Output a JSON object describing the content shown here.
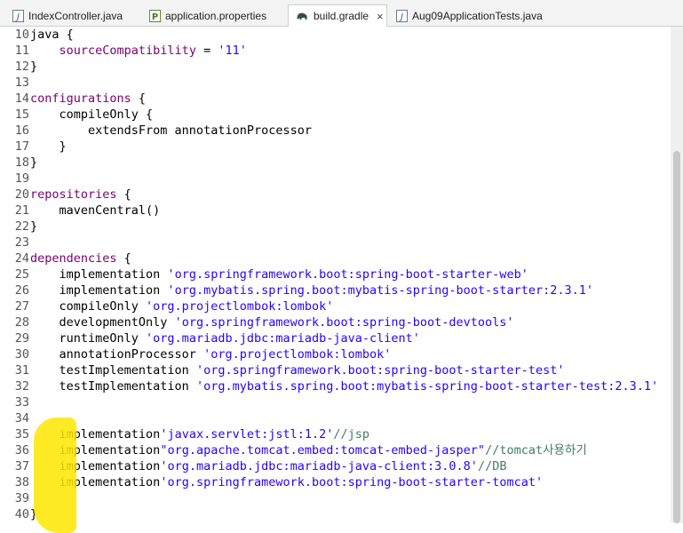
{
  "tabs": [
    {
      "label": "IndexController.java",
      "icon": "java-file-icon",
      "active": false
    },
    {
      "label": "application.properties",
      "icon": "properties-file-icon",
      "active": false
    },
    {
      "label": "build.gradle",
      "icon": "gradle-elephant-icon",
      "active": true,
      "close": "×"
    },
    {
      "label": "Aug09ApplicationTests.java",
      "icon": "java-file-icon",
      "active": false
    }
  ],
  "colors": {
    "string": "#2a00ff",
    "property": "#7a0070",
    "comment": "#3f7f5f",
    "highlight": "#ffe600"
  },
  "lines": [
    {
      "n": "10",
      "segs": [
        [
          "java {",
          ""
        ]
      ]
    },
    {
      "n": "11",
      "segs": [
        [
          "    ",
          ""
        ],
        [
          "sourceCompatibility",
          "prop"
        ],
        [
          " = ",
          ""
        ],
        [
          "'11'",
          "str"
        ]
      ]
    },
    {
      "n": "12",
      "segs": [
        [
          "}",
          ""
        ]
      ]
    },
    {
      "n": "13",
      "segs": []
    },
    {
      "n": "14",
      "segs": [
        [
          "configurations",
          "prop"
        ],
        [
          " {",
          ""
        ]
      ]
    },
    {
      "n": "15",
      "segs": [
        [
          "    compileOnly {",
          ""
        ]
      ]
    },
    {
      "n": "16",
      "segs": [
        [
          "        extendsFrom annotationProcessor",
          ""
        ]
      ]
    },
    {
      "n": "17",
      "segs": [
        [
          "    }",
          ""
        ]
      ]
    },
    {
      "n": "18",
      "segs": [
        [
          "}",
          ""
        ]
      ]
    },
    {
      "n": "19",
      "segs": []
    },
    {
      "n": "20",
      "segs": [
        [
          "repositories",
          "prop"
        ],
        [
          " {",
          ""
        ]
      ]
    },
    {
      "n": "21",
      "segs": [
        [
          "    mavenCentral()",
          ""
        ]
      ]
    },
    {
      "n": "22",
      "segs": [
        [
          "}",
          ""
        ]
      ]
    },
    {
      "n": "23",
      "segs": []
    },
    {
      "n": "24",
      "segs": [
        [
          "dependencies",
          "prop"
        ],
        [
          " {",
          ""
        ]
      ]
    },
    {
      "n": "25",
      "segs": [
        [
          "    implementation ",
          ""
        ],
        [
          "'org.springframework.boot:spring-boot-starter-web'",
          "str"
        ]
      ]
    },
    {
      "n": "26",
      "segs": [
        [
          "    implementation ",
          ""
        ],
        [
          "'org.mybatis.spring.boot:mybatis-spring-boot-starter:2.3.1'",
          "str"
        ]
      ]
    },
    {
      "n": "27",
      "segs": [
        [
          "    compileOnly ",
          ""
        ],
        [
          "'org.projectlombok:lombok'",
          "str"
        ]
      ]
    },
    {
      "n": "28",
      "segs": [
        [
          "    developmentOnly ",
          ""
        ],
        [
          "'org.springframework.boot:spring-boot-devtools'",
          "str"
        ]
      ]
    },
    {
      "n": "29",
      "segs": [
        [
          "    runtimeOnly ",
          ""
        ],
        [
          "'org.mariadb.jdbc:mariadb-java-client'",
          "str"
        ]
      ]
    },
    {
      "n": "30",
      "segs": [
        [
          "    annotationProcessor ",
          ""
        ],
        [
          "'org.projectlombok:lombok'",
          "str"
        ]
      ]
    },
    {
      "n": "31",
      "segs": [
        [
          "    testImplementation ",
          ""
        ],
        [
          "'org.springframework.boot:spring-boot-starter-test'",
          "str"
        ]
      ]
    },
    {
      "n": "32",
      "segs": [
        [
          "    testImplementation ",
          ""
        ],
        [
          "'org.mybatis.spring.boot:mybatis-spring-boot-starter-test:2.3.1'",
          "str"
        ]
      ]
    },
    {
      "n": "33",
      "segs": []
    },
    {
      "n": "34",
      "segs": []
    },
    {
      "n": "35",
      "segs": [
        [
          "    implementation",
          ""
        ],
        [
          "'javax.servlet:jstl:1.2'",
          "str"
        ],
        [
          "//jsp",
          "cmt"
        ]
      ]
    },
    {
      "n": "36",
      "segs": [
        [
          "    implementation",
          ""
        ],
        [
          "\"org.apache.tomcat.embed:tomcat-embed-jasper\"",
          "str"
        ],
        [
          "//tomcat사용하기",
          "cmt"
        ]
      ]
    },
    {
      "n": "37",
      "segs": [
        [
          "    implementation",
          ""
        ],
        [
          "'org.mariadb.jdbc:mariadb-java-client:3.0.8'",
          "str"
        ],
        [
          "//DB",
          "cmt"
        ]
      ]
    },
    {
      "n": "38",
      "segs": [
        [
          "    implementation",
          ""
        ],
        [
          "'org.springframework.boot:spring-boot-starter-tomcat'",
          "str"
        ]
      ]
    },
    {
      "n": "39",
      "segs": []
    },
    {
      "n": "40",
      "segs": [
        [
          "}",
          ""
        ]
      ]
    }
  ]
}
